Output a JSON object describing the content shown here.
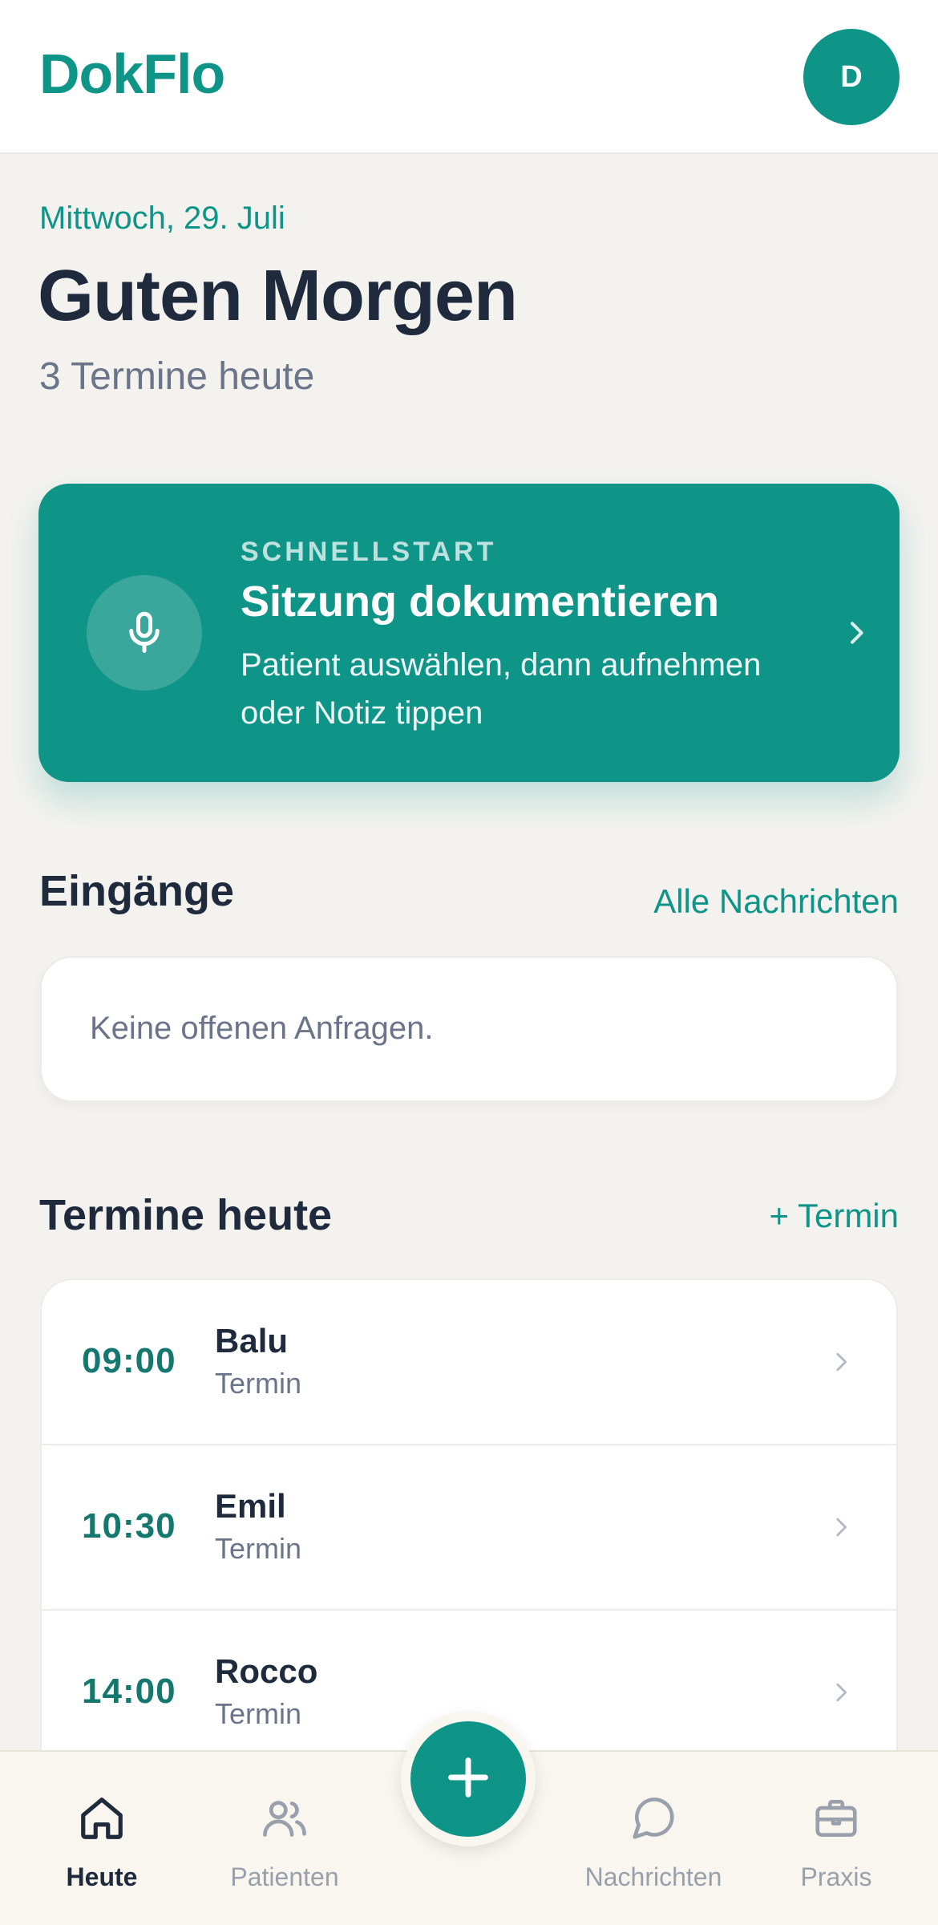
{
  "app": {
    "logo": "DokFlo",
    "avatar_initial": "D"
  },
  "greeting": {
    "date": "Mittwoch, 29. Juli",
    "title": "Guten Morgen",
    "subtitle": "3 Termine heute"
  },
  "quickstart": {
    "eyebrow": "SCHNELLSTART",
    "title": "Sitzung dokumentieren",
    "description": "Patient auswählen, dann aufnehmen oder Notiz tippen",
    "icon": "microphone-icon"
  },
  "inbox": {
    "title": "Eingänge",
    "link": "Alle Nachrichten",
    "empty_text": "Keine offenen Anfragen."
  },
  "appointments": {
    "title": "Termine heute",
    "add_link": "+ Termin",
    "items": [
      {
        "time": "09:00",
        "name": "Balu",
        "type": "Termin"
      },
      {
        "time": "10:30",
        "name": "Emil",
        "type": "Termin"
      },
      {
        "time": "14:00",
        "name": "Rocco",
        "type": "Termin"
      }
    ]
  },
  "bottom_nav": {
    "items": [
      {
        "label": "Heute",
        "icon": "home-icon",
        "active": true
      },
      {
        "label": "Patienten",
        "icon": "users-icon",
        "active": false
      },
      {
        "label": "Nachrichten",
        "icon": "chat-bubble-icon",
        "active": false
      },
      {
        "label": "Praxis",
        "icon": "briefcase-icon",
        "active": false
      }
    ],
    "fab_icon": "plus-icon"
  },
  "colors": {
    "accent": "#0f9488",
    "text_dark": "#1f2a3c",
    "text_muted": "#6b7489",
    "background": "#f3f2ef"
  }
}
